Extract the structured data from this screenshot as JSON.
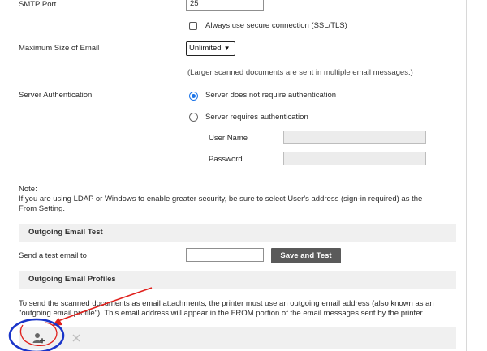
{
  "smtp": {
    "port_label": "SMTP Port",
    "port_value": "25",
    "secure_label": "Always use secure connection (SSL/TLS)"
  },
  "max_size": {
    "label": "Maximum Size of Email",
    "selected": "Unlimited",
    "hint": "(Larger scanned documents are sent in multiple email messages.)"
  },
  "auth": {
    "label": "Server Authentication",
    "option_none": "Server does not require authentication",
    "option_required": "Server requires authentication",
    "username_label": "User Name",
    "password_label": "Password"
  },
  "note": {
    "title": "Note:",
    "line1": "If you are using LDAP or Windows to enable greater security, be sure to select User's address (sign-in required) as the",
    "line2": "From Setting."
  },
  "test": {
    "section_title": "Outgoing Email Test",
    "send_label": "Send a test email to",
    "email_value": "",
    "button_label": "Save and Test"
  },
  "profiles": {
    "section_title": "Outgoing Email Profiles",
    "desc_line1": "To send the scanned documents as email attachments, the printer must use an outgoing email address (also known as an",
    "desc_line2": "\"outgoing email profile\"). This email address will appear in the FROM portion of the email messages sent by the printer.",
    "add_icon": "add-user-icon",
    "delete_icon": "close-icon"
  },
  "colors": {
    "accent": "#1a73e8",
    "annotation_red": "#e0201c",
    "annotation_blue": "#1a35c9"
  }
}
